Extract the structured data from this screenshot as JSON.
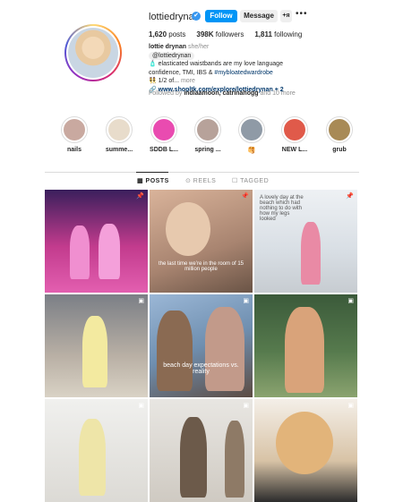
{
  "profile": {
    "username": "lottiedrynan",
    "verified_icon": "✔",
    "follow_label": "Follow",
    "message_label": "Message",
    "suggest_icon": "+ᴙ",
    "more_icon": "•••",
    "posts_count": "1,620",
    "posts_label": "posts",
    "followers_count": "398K",
    "followers_label": "followers",
    "following_count": "1,811",
    "following_label": "following",
    "display_name": "lottie drynan",
    "pronouns": "she/her",
    "threads_handle": "@lottiedrynan",
    "bio_line1": "🧴 elasticated waistbands are my love language",
    "bio_line2": "confidence, TMI, IBS &",
    "bio_tag": "#mybloatedwardrobe",
    "bio_line3": "👯 1/2 of...",
    "bio_more": "more",
    "link": "🔗 www.shopltk.com/explore/lottiedrynan + 2",
    "followed_prefix": "Followed by",
    "followed_names": "indiaamoon, catrinahogg",
    "followed_suffix": "and 10 more"
  },
  "highlights": [
    {
      "label": "nails",
      "color": "#c9a9a0"
    },
    {
      "label": "summe...",
      "color": "#e8dccb"
    },
    {
      "label": "SDDB L...",
      "color": "#e94bb0"
    },
    {
      "label": "spring ...",
      "color": "#b7a29a"
    },
    {
      "label": "🥞",
      "color": "#8f9aa6"
    },
    {
      "label": "NEW L...",
      "color": "#e05a4a"
    },
    {
      "label": "grub",
      "color": "#a88a56"
    }
  ],
  "tabs": {
    "posts": "▦ POSTS",
    "reels": "⊙ REELS",
    "tagged": "☐ TAGGED"
  },
  "posts": [
    {
      "badge": "📌",
      "caption": ""
    },
    {
      "badge": "📌",
      "caption": "the last time we’re in the room of 15 million people"
    },
    {
      "badge": "📌",
      "caption": "A lovely day at the beach which had nothing to do with how my legs looked"
    },
    {
      "badge": "▣",
      "caption": ""
    },
    {
      "badge": "▣",
      "caption": "beach day expectations vs. reality"
    },
    {
      "badge": "▣",
      "caption": ""
    },
    {
      "badge": "▣",
      "caption": ""
    },
    {
      "badge": "▣",
      "caption": ""
    },
    {
      "badge": "▣",
      "caption": ""
    }
  ]
}
